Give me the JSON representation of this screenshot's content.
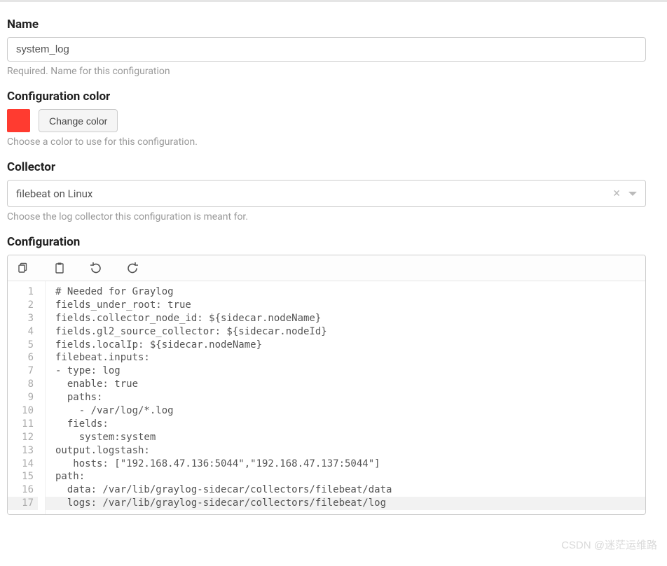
{
  "name": {
    "label": "Name",
    "value": "system_log",
    "help": "Required. Name for this configuration"
  },
  "color": {
    "label": "Configuration color",
    "swatch": "#ff3b30",
    "button": "Change color",
    "help": "Choose a color to use for this configuration."
  },
  "collector": {
    "label": "Collector",
    "value": "filebeat on Linux",
    "help": "Choose the log collector this configuration is meant for."
  },
  "configuration": {
    "label": "Configuration",
    "lines": [
      "# Needed for Graylog",
      "fields_under_root: true",
      "fields.collector_node_id: ${sidecar.nodeName}",
      "fields.gl2_source_collector: ${sidecar.nodeId}",
      "fields.localIp: ${sidecar.nodeName}",
      "filebeat.inputs:",
      "- type: log",
      "  enable: true",
      "  paths:",
      "    - /var/log/*.log",
      "  fields:",
      "    system:system",
      "output.logstash:",
      "   hosts: [\"192.168.47.136:5044\",\"192.168.47.137:5044\"]",
      "path:",
      "  data: /var/lib/graylog-sidecar/collectors/filebeat/data",
      "  logs: /var/lib/graylog-sidecar/collectors/filebeat/log"
    ],
    "highlight_line": 17
  },
  "watermark": "CSDN @迷茫运维路"
}
